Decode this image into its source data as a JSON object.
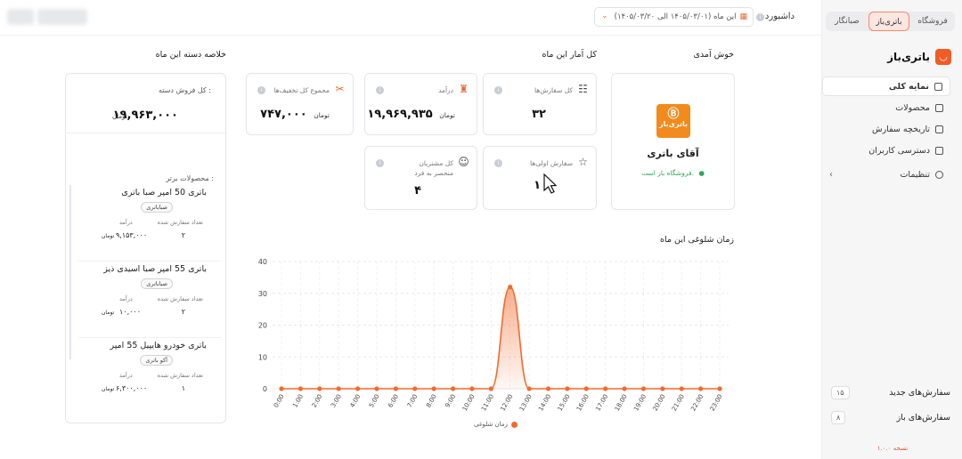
{
  "sidebar": {
    "tabs": [
      "فروشگاه",
      "باتری‌باز",
      "صبانگار"
    ],
    "brand": "باتری‌باز",
    "items": [
      {
        "label": "نمایه کلی"
      },
      {
        "label": "محصولات"
      },
      {
        "label": "تاریخچه سفارش"
      },
      {
        "label": "دسترسی کاربران"
      },
      {
        "label": "تنظیمات"
      }
    ],
    "counts": [
      {
        "label": "سفارش‌های جدید",
        "value": "۱۵"
      },
      {
        "label": "سفارش‌های باز",
        "value": "۸"
      }
    ],
    "version": "نسخه ۱.۰.۰"
  },
  "header": {
    "title": "داشبورد",
    "date_range": "این ماه (۱۴۰۵/۰۳/۰۱ الی ۱۴۰۵/۰۳/۲۰)"
  },
  "welcome": {
    "title": "خوش آمدی",
    "logo_text": "باتری‌باز",
    "name": "آقای باتری",
    "status": "فروشگاه باز است.",
    "status_color": "#2aa85a"
  },
  "stats": {
    "title": "کل آمار  این ماه",
    "cards": [
      {
        "label": "کل سفارش‌ها",
        "value": "۳۲",
        "unit": "",
        "icon": "order-list-icon"
      },
      {
        "label": "درآمد",
        "value": "۱۹,۹۶۹,۹۳۵",
        "unit": "تومان",
        "icon": "money-bag-icon"
      },
      {
        "label": "مجموع کل تخفیف‌ها",
        "value": "۷۴۷,۰۰۰",
        "unit": "تومان",
        "icon": "discount-ticket-icon"
      },
      {
        "label": "سفارش اولی‌ها",
        "value": "۱",
        "unit": "",
        "icon": "star-icon"
      },
      {
        "label": "کل مشتریان\nمنحصر به فرد",
        "value": "۴",
        "unit": "",
        "icon": "customer-icon"
      }
    ]
  },
  "summary": {
    "title": "خلاصه دسته  این ماه",
    "total_label": "کل فروش دسته :",
    "total_value": "۱۹,۹۶۳,۰۰۰",
    "total_unit": "تومان",
    "top_label": "محصولات برتر :",
    "col_count": "تعداد سفارش شده",
    "col_income": "درآمد",
    "products": [
      {
        "name": "باتری 50 آمپر صبا باتری",
        "tag": "صباباتری",
        "count": "۲",
        "income": "۹,۱۵۳,۰۰۰",
        "unit": "تومان"
      },
      {
        "name": "باتری 55 آمپر صبا اسیدی ذیز",
        "tag": "صباباتری",
        "count": "۲",
        "income": "۱۰,۰۰۰",
        "unit": "تومان"
      },
      {
        "name": "باتری خودرو هایپیل 55 آمپر",
        "tag": "آکو باتری",
        "count": "۱",
        "income": "۶,۳۰۰,۰۰۰",
        "unit": "تومان"
      }
    ]
  },
  "chart_title": "زمان شلوغی  این ماه",
  "chart_data": {
    "type": "area",
    "x": [
      "0:00",
      "1:00",
      "2:00",
      "3:00",
      "4:00",
      "5:00",
      "6:00",
      "7:00",
      "8:00",
      "9:00",
      "10:00",
      "11:00",
      "12:00",
      "13:00",
      "14:00",
      "15:00",
      "16:00",
      "17:00",
      "18:00",
      "19:00",
      "20:00",
      "21:00",
      "22:00",
      "23:00"
    ],
    "series": [
      {
        "name": "زمان شلوغی",
        "values": [
          0,
          0,
          0,
          0,
          0,
          0,
          0,
          0,
          0,
          0,
          0,
          0,
          32,
          0,
          0,
          0,
          0,
          0,
          0,
          0,
          0,
          0,
          0,
          0
        ]
      }
    ],
    "yticks": [
      0,
      10,
      20,
      30,
      40
    ],
    "ylim": [
      0,
      40
    ],
    "color": "#f26b2c",
    "legend": "bottom-center",
    "grid": true
  }
}
